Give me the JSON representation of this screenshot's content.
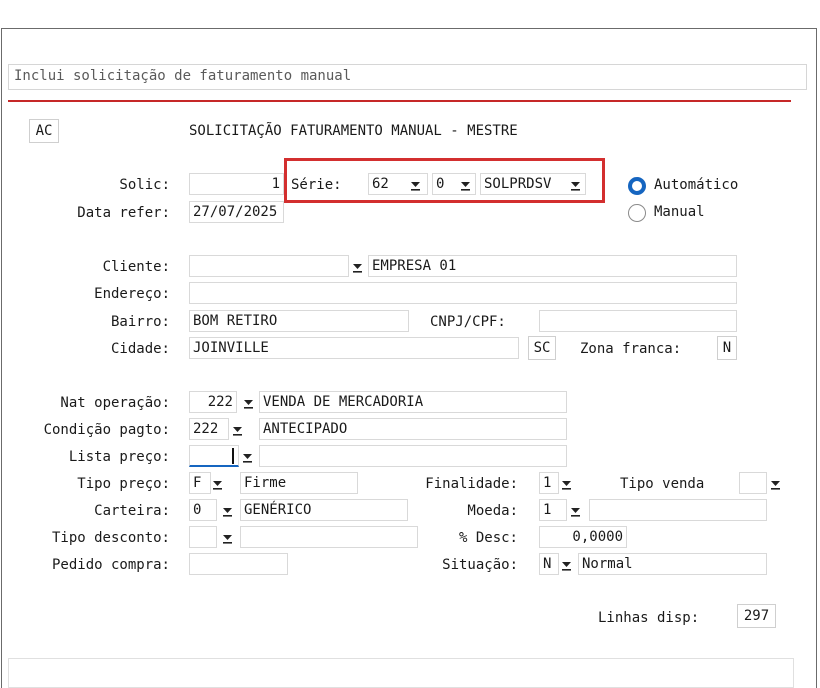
{
  "command": {
    "text": "Inclui solicitação de faturamento manual"
  },
  "header": {
    "ac_label": "AC",
    "title": "SOLICITAÇÃO FATURAMENTO MANUAL - MESTRE"
  },
  "solic": {
    "label": "Solic:",
    "value": "1",
    "serie_label": "Série:",
    "serie_value": "62",
    "serie_sub": "0",
    "serie_code": "SOLPRDSV",
    "radio_auto": "Automático",
    "radio_manual": "Manual",
    "selected": "Automático"
  },
  "data_refer": {
    "label": "Data refer:",
    "value": "27/07/2025"
  },
  "cliente": {
    "label": "Cliente:",
    "code": "",
    "name": "EMPRESA 01"
  },
  "endereco": {
    "label": "Endereço:",
    "value": ""
  },
  "bairro": {
    "label": "Bairro:",
    "value": "BOM RETIRO",
    "cnpj_label": "CNPJ/CPF:",
    "cnpj_value": ""
  },
  "cidade": {
    "label": "Cidade:",
    "value": "JOINVILLE",
    "uf": "SC",
    "zona_label": "Zona franca:",
    "zona_value": "N"
  },
  "nat_operacao": {
    "label": "Nat operação:",
    "code": "222",
    "desc": "VENDA DE MERCADORIA"
  },
  "condicao_pagto": {
    "label": "Condição pagto:",
    "code": "222",
    "desc": "ANTECIPADO"
  },
  "lista_preco": {
    "label": "Lista preço:",
    "code": "",
    "desc": ""
  },
  "tipo_preco": {
    "label": "Tipo preço:",
    "code": "F",
    "desc": "Firme",
    "finalidade_label": "Finalidade:",
    "finalidade_value": "1",
    "tipo_venda_label": "Tipo venda",
    "tipo_venda_value": ""
  },
  "carteira": {
    "label": "Carteira:",
    "code": "0",
    "desc": "GENÉRICO",
    "moeda_label": "Moeda:",
    "moeda_value": "1",
    "moeda_desc": ""
  },
  "tipo_desconto": {
    "label": "Tipo desconto:",
    "code": "",
    "desc": "",
    "desc_pct_label": "% Desc:",
    "desc_pct_value": "0,0000"
  },
  "pedido_compra": {
    "label": "Pedido compra:",
    "value": "",
    "situacao_label": "Situação:",
    "situacao_code": "N",
    "situacao_desc": "Normal"
  },
  "linhas_disp": {
    "label": "Linhas disp:",
    "value": "297"
  },
  "colors": {
    "accent": "#1565c0",
    "highlight": "#d32f2f"
  },
  "icons": {
    "dropdown": "dropdown-arrow-icon"
  }
}
